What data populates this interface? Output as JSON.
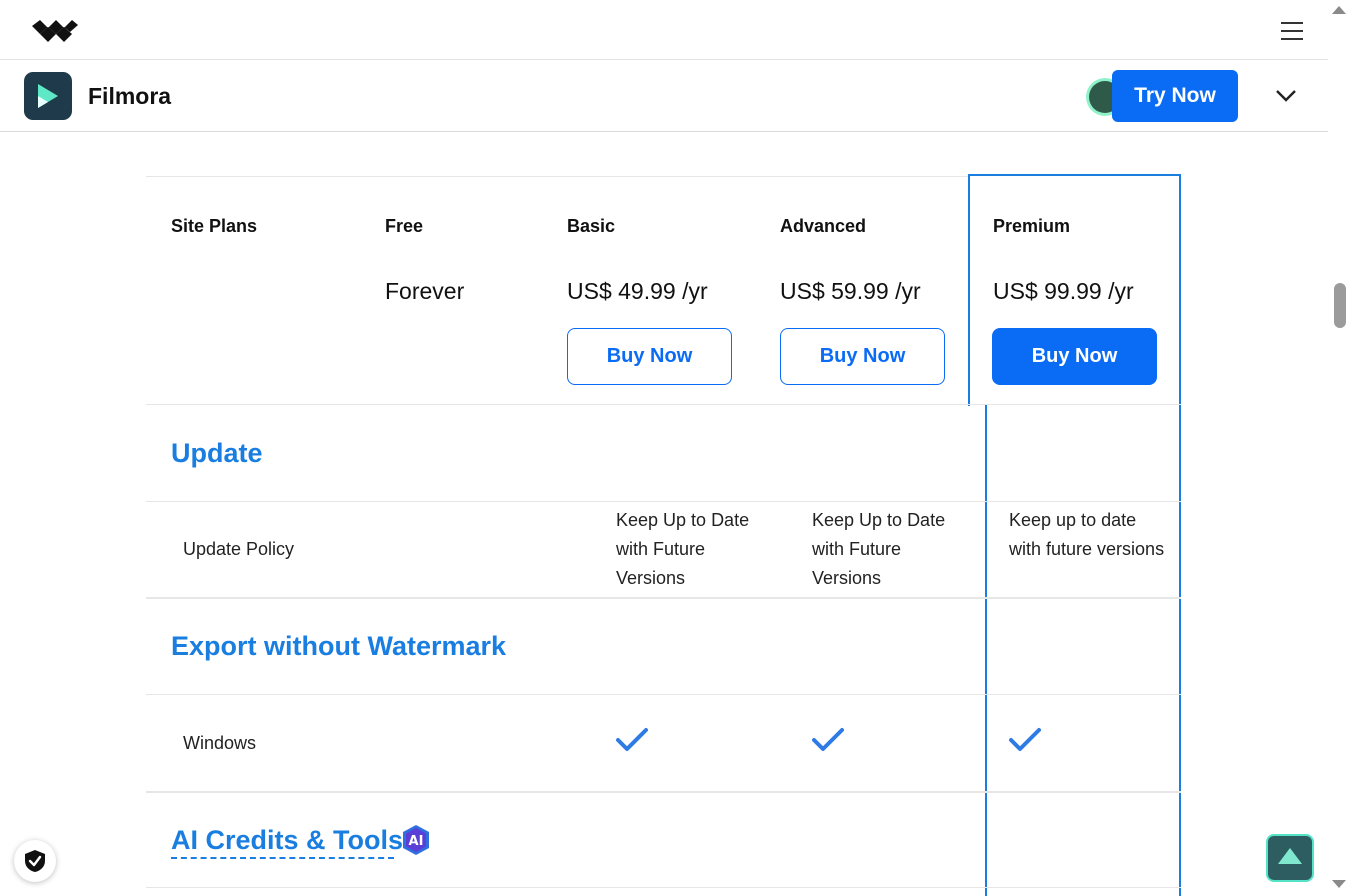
{
  "header": {
    "menu_icon": "hamburger-icon",
    "brand_icon": "wondershare-logo"
  },
  "product": {
    "name": "Filmora",
    "cta": "Try Now",
    "expand_icon": "chevron-down-icon"
  },
  "plans": {
    "site_label": "Site Plans",
    "columns": [
      {
        "name": "Free",
        "price": "Forever",
        "button": ""
      },
      {
        "name": "Basic",
        "price": "US$ 49.99 /yr",
        "button": "Buy Now"
      },
      {
        "name": "Advanced",
        "price": "US$ 59.99 /yr",
        "button": "Buy Now"
      },
      {
        "name": "Premium",
        "price": "US$ 99.99 /yr",
        "button": "Buy Now"
      }
    ]
  },
  "sections": {
    "update": {
      "title": "Update",
      "row_label": "Update Policy",
      "basic": "Keep Up to Date with Future Versions",
      "advanced": "Keep Up to Date with Future Versions",
      "premium": "Keep up to date with future versions"
    },
    "export": {
      "title": "Export without Watermark",
      "row_label": "Windows"
    },
    "ai": {
      "title": "AI Credits & Tools",
      "badge": "AI"
    }
  },
  "colors": {
    "accent": "#0a6cf5",
    "section": "#1a7ee0",
    "highlight": "#1a7ee0"
  }
}
